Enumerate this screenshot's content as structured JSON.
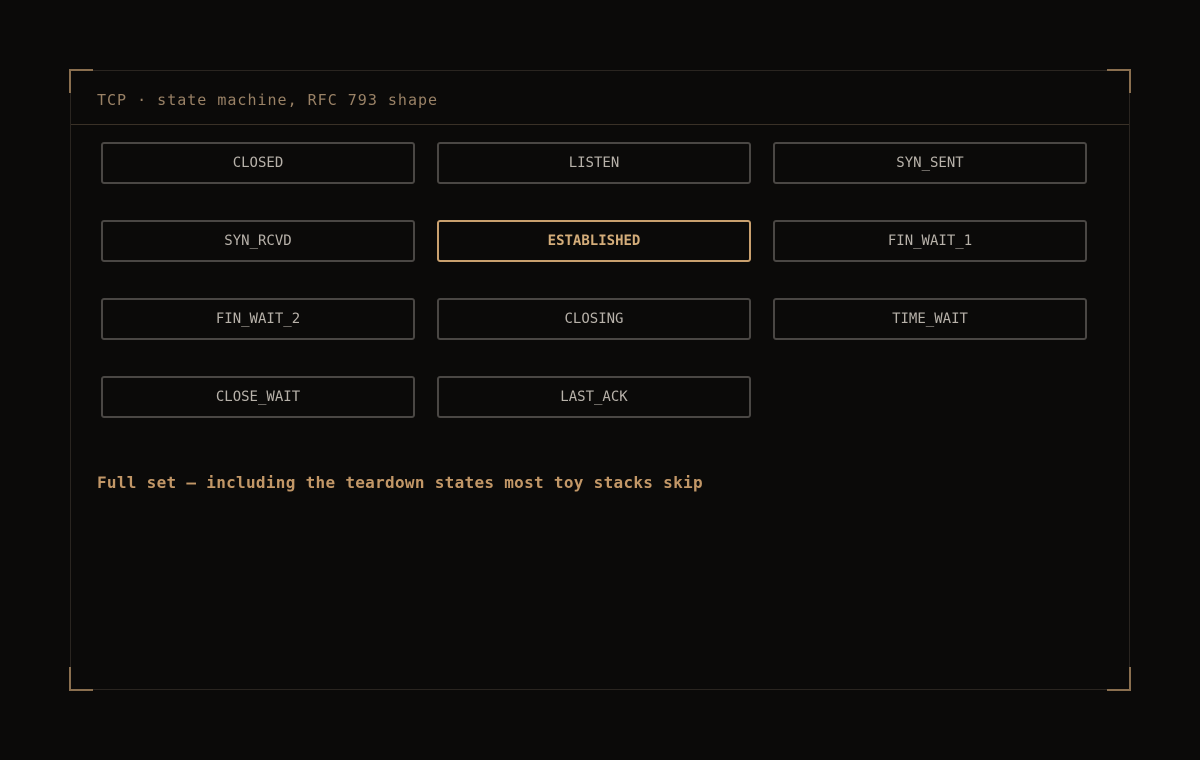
{
  "panel": {
    "title": "TCP · state machine, RFC 793 shape"
  },
  "states": [
    {
      "label": "CLOSED",
      "active": false
    },
    {
      "label": "LISTEN",
      "active": false
    },
    {
      "label": "SYN_SENT",
      "active": false
    },
    {
      "label": "SYN_RCVD",
      "active": false
    },
    {
      "label": "ESTABLISHED",
      "active": true
    },
    {
      "label": "FIN_WAIT_1",
      "active": false
    },
    {
      "label": "FIN_WAIT_2",
      "active": false
    },
    {
      "label": "CLOSING",
      "active": false
    },
    {
      "label": "TIME_WAIT",
      "active": false
    },
    {
      "label": "CLOSE_WAIT",
      "active": false
    },
    {
      "label": "LAST_ACK",
      "active": false
    }
  ],
  "caption": "Full set — including the teardown states most toy stacks skip",
  "colors": {
    "accent": "#c9a06e",
    "background": "#0b0a09",
    "state_border": "#4a4744",
    "state_text": "#b8b2aa",
    "title_text": "#9a8266"
  }
}
